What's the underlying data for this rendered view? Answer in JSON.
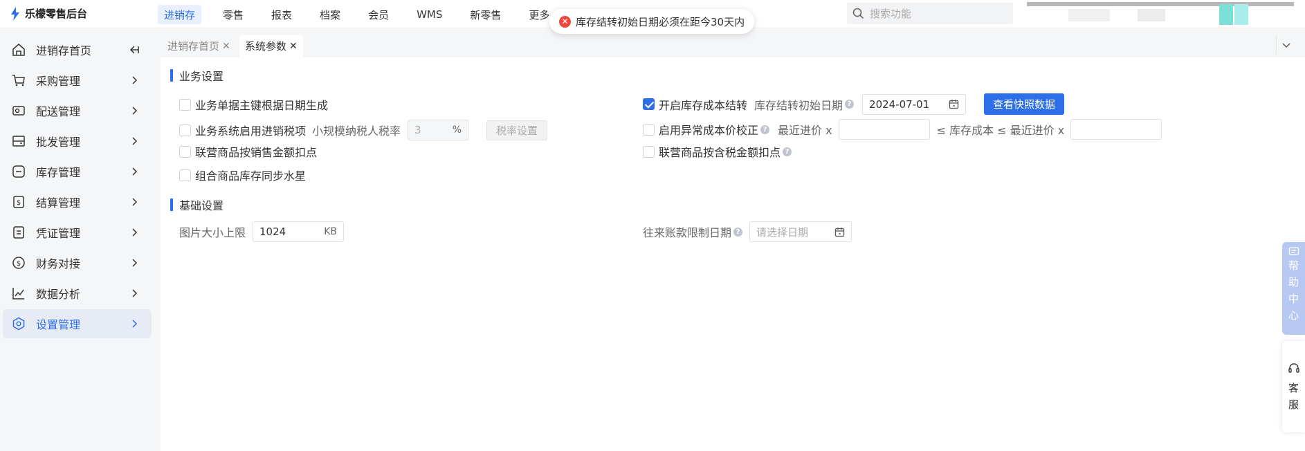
{
  "app": {
    "name": "乐檬零售后台"
  },
  "topnav": [
    "进销存",
    "零售",
    "报表",
    "档案",
    "会员",
    "WMS",
    "新零售",
    "更多"
  ],
  "search": {
    "placeholder": "搜索功能"
  },
  "toast": {
    "message": "库存结转初始日期必须在距今30天内"
  },
  "sidebar": {
    "items": [
      {
        "label": "进销存首页",
        "icon": "home-icon"
      },
      {
        "label": "采购管理",
        "icon": "cart-icon"
      },
      {
        "label": "配送管理",
        "icon": "truck-icon"
      },
      {
        "label": "批发管理",
        "icon": "box-icon"
      },
      {
        "label": "库存管理",
        "icon": "inventory-icon"
      },
      {
        "label": "结算管理",
        "icon": "dollar-doc-icon"
      },
      {
        "label": "凭证管理",
        "icon": "voucher-icon"
      },
      {
        "label": "财务对接",
        "icon": "coin-icon"
      },
      {
        "label": "数据分析",
        "icon": "chart-icon"
      },
      {
        "label": "设置管理",
        "icon": "settings-icon",
        "active": true
      }
    ]
  },
  "tabs": [
    {
      "label": "进销存首页"
    },
    {
      "label": "系统参数",
      "active": true
    }
  ],
  "business": {
    "title": "业务设置",
    "opt1": "业务单据主键根据日期生成",
    "opt2": "业务系统启用进销税项",
    "taxrate_label": "小规模纳税人税率",
    "taxrate_value": "3",
    "taxrate_unit": "%",
    "taxrate_btn": "税率设置",
    "opt3": "联营商品按销售金额扣点",
    "opt4": "组合商品库存同步水星",
    "cost_rollover": "开启库存成本结转",
    "rollover_date_label": "库存结转初始日期",
    "rollover_date_value": "2024-07-01",
    "snapshot_btn": "查看快照数据",
    "abnormal_cost": "启用异常成本价校正",
    "recent_price_label": "最近进价 x",
    "le_cost_label": "≤ 库存成本 ≤ 最近进价 x",
    "joint_tax": "联营商品按含税金额扣点"
  },
  "basic": {
    "title": "基础设置",
    "img_label": "图片大小上限",
    "img_value": "1024",
    "img_unit": "KB",
    "ar_label": "往来账款限制日期",
    "ar_placeholder": "请选择日期"
  },
  "float": {
    "help": [
      "帮",
      "助",
      "中",
      "心"
    ],
    "cs": [
      "客",
      "服"
    ]
  },
  "colors": {
    "accent": "#2d6fe8",
    "error": "#f0453a",
    "help_bg": "#b7c9f2"
  }
}
